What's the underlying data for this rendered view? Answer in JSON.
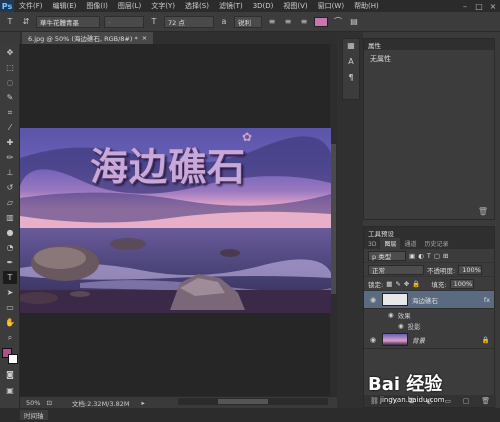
{
  "app": {
    "logo": "Ps"
  },
  "menu": [
    "文件(F)",
    "编辑(E)",
    "图像(I)",
    "图层(L)",
    "文字(Y)",
    "选择(S)",
    "滤镜(T)",
    "3D(D)",
    "视图(V)",
    "窗口(W)",
    "帮助(H)"
  ],
  "window_controls": [
    "–",
    "□",
    "×"
  ],
  "options": {
    "tool_icon": "T",
    "font_family": "華牛花體青墨",
    "font_style": "-",
    "font_size": "72 点",
    "antialias": "锐利",
    "text_color": "#c875b0"
  },
  "document": {
    "tab": "6.jpg @ 50% (海边礁石, RGB/8#) *",
    "close": "×"
  },
  "canvas_text": "海边礁石",
  "status": {
    "zoom": "50%",
    "doc_info": "文档:2.32M/3.82M"
  },
  "timeline": {
    "label": "时间轴"
  },
  "properties": {
    "title": "属性",
    "body": "无属性"
  },
  "layers_panel": {
    "tabs": [
      "3D",
      "图层",
      "通道",
      "历史记录"
    ],
    "filter_kind": "p 类型",
    "blend_mode": "正常",
    "opacity_label": "不透明度:",
    "opacity_value": "100%",
    "lock_label": "锁定:",
    "fill_label": "填充:",
    "fill_value": "100%",
    "layers": [
      {
        "name": "海边礁石",
        "fx": "fx",
        "effects_label": "效果",
        "effect": "投影"
      },
      {
        "name": "背景"
      }
    ]
  },
  "tool_presets_label": "工具预设",
  "watermark": {
    "brand": "Bai 经验",
    "url": "jingyan.baidu.com"
  }
}
